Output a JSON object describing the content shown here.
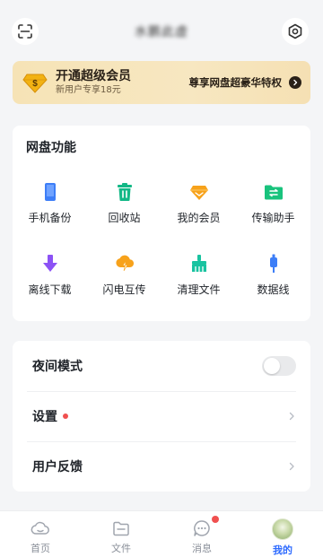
{
  "header": {
    "username": "水鹏此虚",
    "scan_icon": "scan-icon",
    "settings_icon": "settings-gear-icon"
  },
  "vip_banner": {
    "title": "开通超级会员",
    "subtitle": "新用户专享18元",
    "right_text": "尊享网盘超豪华特权",
    "accent": "#f6e3b6",
    "icon": "diamond-dollar-icon"
  },
  "functions": {
    "title": "网盘功能",
    "items": [
      {
        "label": "手机备份",
        "icon": "phone-backup-icon",
        "color": "#3d7ef7"
      },
      {
        "label": "回收站",
        "icon": "recycle-bin-icon",
        "color": "#12b886"
      },
      {
        "label": "我的会员",
        "icon": "vip-diamond-icon",
        "color": "#f7a21b"
      },
      {
        "label": "传输助手",
        "icon": "transfer-folder-icon",
        "color": "#19c37d"
      },
      {
        "label": "离线下载",
        "icon": "offline-download-icon",
        "color": "#8c52f5"
      },
      {
        "label": "闪电互传",
        "icon": "lightning-cloud-icon",
        "color": "#f7a21b"
      },
      {
        "label": "清理文件",
        "icon": "broom-icon",
        "color": "#19c3a0"
      },
      {
        "label": "数据线",
        "icon": "data-cable-icon",
        "color": "#3d7ef7"
      }
    ]
  },
  "settings": {
    "night_mode": {
      "label": "夜间模式",
      "enabled": false
    },
    "settings": {
      "label": "设置",
      "badge": true
    },
    "feedback": {
      "label": "用户反馈"
    }
  },
  "bottom_nav": {
    "items": [
      {
        "label": "首页",
        "icon": "home-cloud-icon",
        "active": false
      },
      {
        "label": "文件",
        "icon": "folder-icon",
        "active": false
      },
      {
        "label": "消息",
        "icon": "message-bubble-icon",
        "active": false,
        "badge": true
      },
      {
        "label": "我的",
        "icon": "avatar",
        "active": true
      }
    ],
    "active_color": "#2e6bff"
  }
}
